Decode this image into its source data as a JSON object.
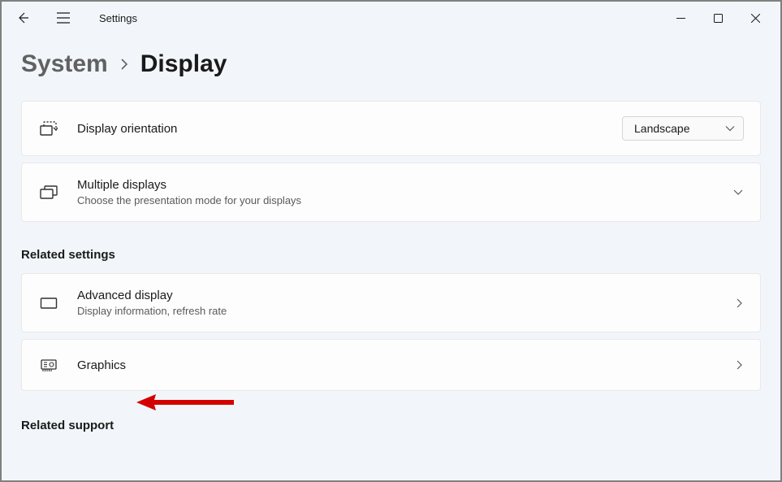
{
  "app": {
    "title": "Settings"
  },
  "breadcrumb": {
    "parent": "System",
    "current": "Display"
  },
  "rows": {
    "orientation": {
      "title": "Display orientation",
      "value": "Landscape"
    },
    "multiple": {
      "title": "Multiple displays",
      "sub": "Choose the presentation mode for your displays"
    },
    "advanced": {
      "title": "Advanced display",
      "sub": "Display information, refresh rate"
    },
    "graphics": {
      "title": "Graphics"
    }
  },
  "sections": {
    "related_settings": "Related settings",
    "related_support": "Related support"
  }
}
